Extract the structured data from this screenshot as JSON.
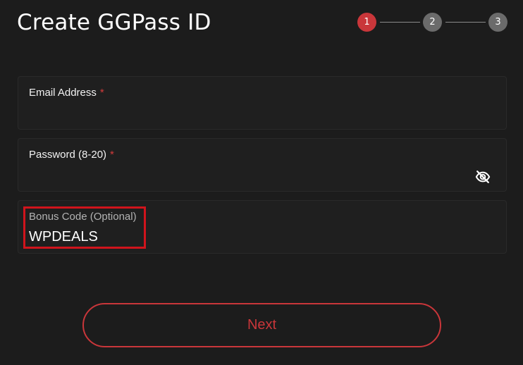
{
  "header": {
    "title": "Create GGPass ID"
  },
  "stepper": {
    "steps": [
      "1",
      "2",
      "3"
    ],
    "active_step": 1
  },
  "form": {
    "email": {
      "label": "Email Address",
      "required_mark": "*",
      "value": ""
    },
    "password": {
      "label": "Password (8-20)",
      "required_mark": "*",
      "value": "",
      "toggle_icon": "eye-off-icon"
    },
    "bonus_code": {
      "label": "Bonus Code (Optional)",
      "value": "WPDEALS"
    }
  },
  "actions": {
    "next_label": "Next"
  },
  "colors": {
    "background": "#1c1c1c",
    "accent": "#c9363a",
    "inactive_step": "#6b6b6b",
    "highlight_box": "#d0141c"
  }
}
